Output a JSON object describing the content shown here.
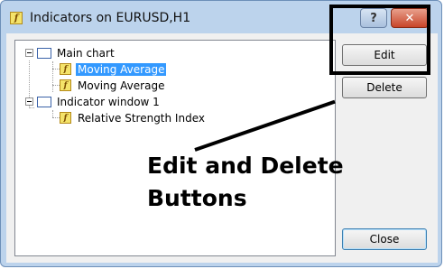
{
  "window": {
    "title": "Indicators on EURUSD,H1",
    "help_label": "?",
    "close_label": "✕"
  },
  "tree": [
    {
      "label": "Main chart",
      "icon": "chart-icon",
      "selected": false
    },
    {
      "label": "Moving Average",
      "icon": "indicator-icon",
      "selected": true
    },
    {
      "label": "Moving Average",
      "icon": "indicator-icon",
      "selected": false
    },
    {
      "label": "Indicator window 1",
      "icon": "chart-icon",
      "selected": false
    },
    {
      "label": "Relative Strength Index",
      "icon": "indicator-icon",
      "selected": false
    }
  ],
  "buttons": {
    "edit": "Edit",
    "delete": "Delete",
    "close": "Close"
  },
  "annotation": {
    "line1": "Edit and Delete",
    "line2": "Buttons"
  },
  "indicator_glyph": "f"
}
